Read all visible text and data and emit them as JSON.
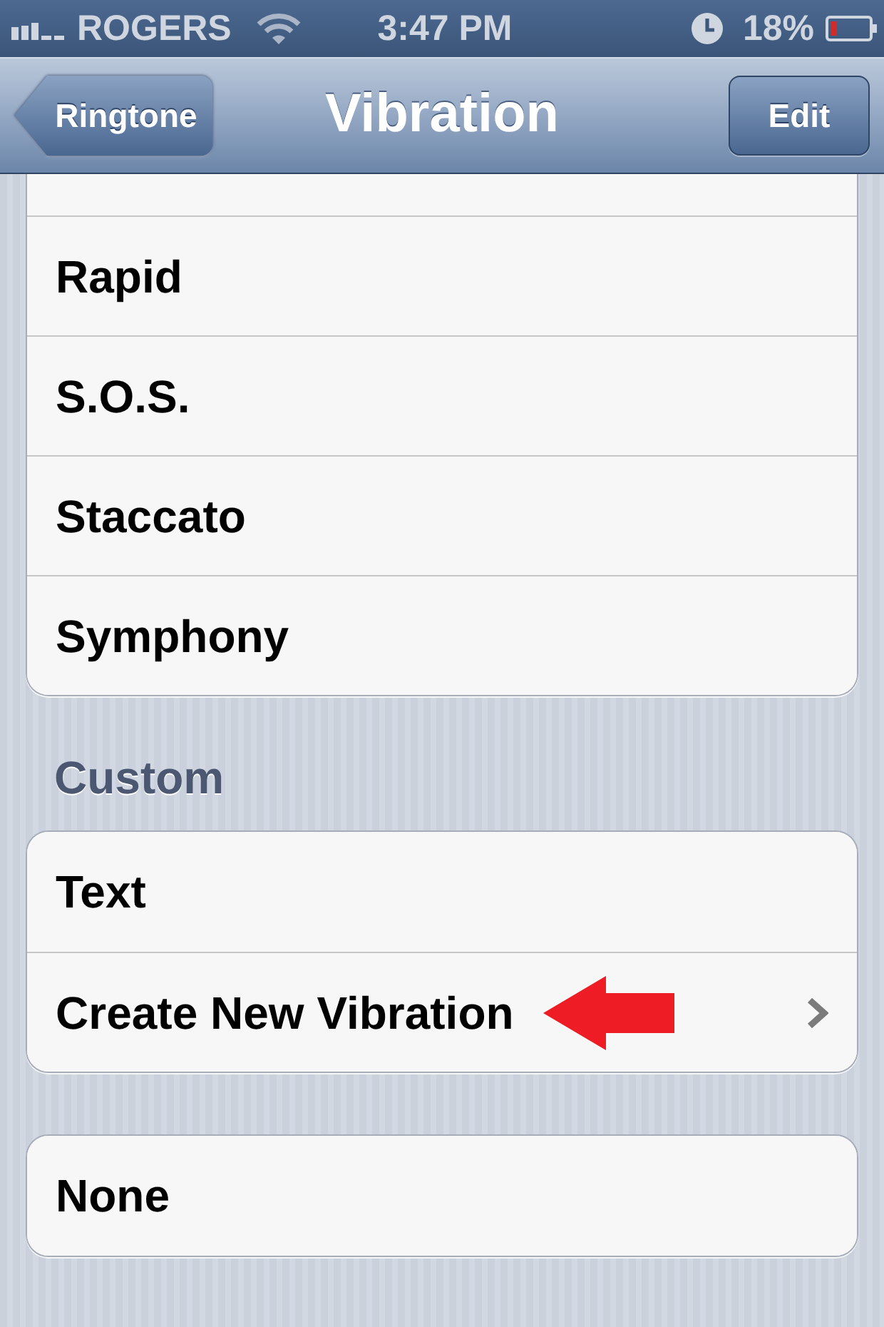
{
  "status_bar": {
    "carrier": "ROGERS",
    "time": "3:47 PM",
    "battery": "18%"
  },
  "nav_bar": {
    "back_button": "Ringtone",
    "title": "Vibration",
    "edit_button": "Edit"
  },
  "groups": [
    {
      "cut_off_top": true,
      "rows": [
        {
          "label": "Rapid",
          "selected": false,
          "disclosure": false,
          "annotated": false
        },
        {
          "label": "S.O.S.",
          "selected": false,
          "disclosure": false,
          "annotated": false
        },
        {
          "label": "Staccato",
          "selected": false,
          "disclosure": false,
          "annotated": false
        },
        {
          "label": "Symphony",
          "selected": false,
          "disclosure": false,
          "annotated": false
        }
      ]
    },
    {
      "header": "Custom",
      "cut_off_top": false,
      "rows": [
        {
          "label": "Text",
          "selected": false,
          "disclosure": false,
          "annotated": false
        },
        {
          "label": "Create New Vibration",
          "selected": false,
          "disclosure": true,
          "annotated": true
        }
      ]
    },
    {
      "cut_off_top": false,
      "rows": [
        {
          "label": "None",
          "selected": false,
          "disclosure": false,
          "annotated": false
        }
      ]
    }
  ]
}
